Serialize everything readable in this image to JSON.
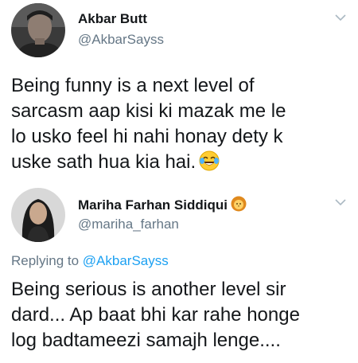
{
  "tweet1": {
    "display_name": "Akbar Butt",
    "handle": "@AkbarSayss",
    "avatar_icon": "profile-photo-man",
    "menu_icon": "chevron-down-icon",
    "lines": [
      "Being funny is a next level of",
      "sarcasm aap kisi ki mazak me le",
      "lo usko feel hi nahi honay dety k",
      "uske sath hua kia hai."
    ],
    "emoji": "face-with-tears-of-joy"
  },
  "tweet2": {
    "display_name": "Mariha Farhan Siddiqui",
    "name_emoji": "lion-face",
    "handle": "@mariha_farhan",
    "avatar_icon": "profile-photo-woman",
    "menu_icon": "chevron-down-icon",
    "replying_prefix": "Replying to",
    "replying_mention": "@AkbarSayss",
    "lines": [
      "Being serious is another level sir",
      "dard... Ap baat bhi kar rahe honge",
      "log badtameezi samajh lenge...."
    ]
  },
  "colors": {
    "text": "#14171a",
    "secondary": "#657786",
    "link": "#1da1f2"
  }
}
